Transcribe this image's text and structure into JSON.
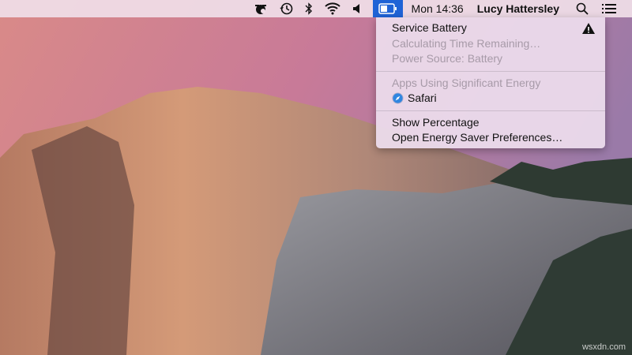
{
  "menubar": {
    "icons": [
      "time-machine-sync-icon",
      "clock-history-icon",
      "bluetooth-icon",
      "wifi-icon",
      "volume-icon",
      "battery-icon"
    ],
    "clock": "Mon 14:36",
    "user": "Lucy Hattersley",
    "accent": "#1f63d6"
  },
  "battery_menu": {
    "service": "Service Battery",
    "time_remaining": "Calculating Time Remaining…",
    "power_source": "Power Source: Battery",
    "apps_header": "Apps Using Significant Energy",
    "app": "Safari",
    "show_percentage": "Show Percentage",
    "energy_prefs": "Open Energy Saver Preferences…"
  },
  "watermark": "wsxdn.com"
}
